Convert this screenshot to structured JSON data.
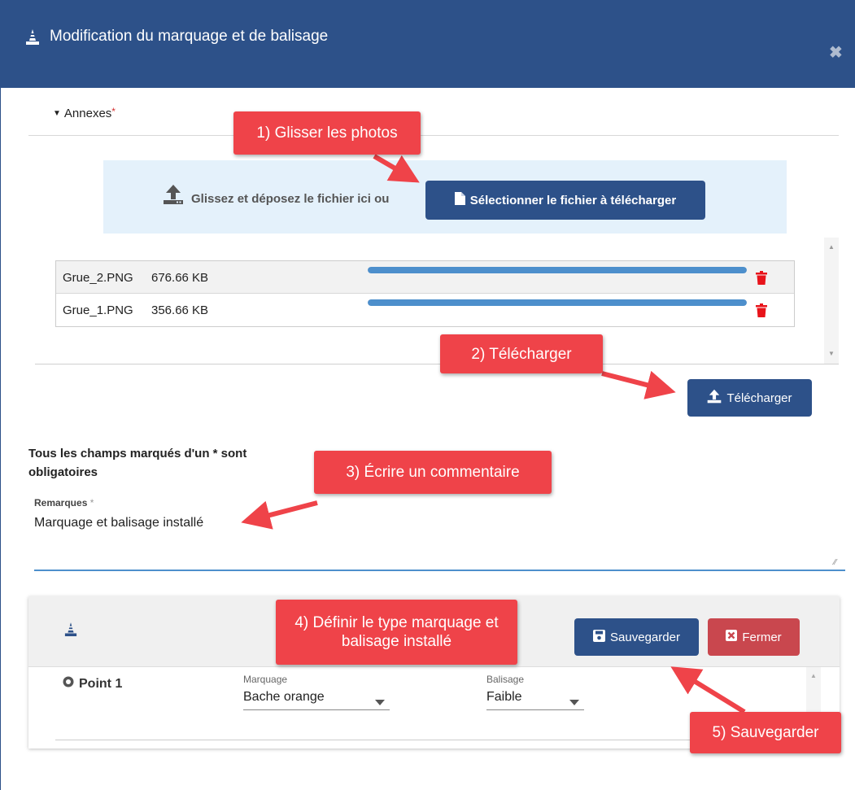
{
  "dialog": {
    "title": "Modification du marquage et de balisage",
    "close_symbol": "✖"
  },
  "annexes": {
    "label": "Annexes",
    "required_mark": "*"
  },
  "dropzone": {
    "text": "Glissez et déposez le fichier ici ou",
    "select_button": "Sélectionner le fichier à télécharger"
  },
  "files": [
    {
      "name": "Grue_2.PNG",
      "size": "676.66 KB",
      "progress": 1.0
    },
    {
      "name": "Grue_1.PNG",
      "size": "356.66 KB",
      "progress": 1.0
    }
  ],
  "upload_button": "Télécharger",
  "form": {
    "required_note": "Tous les champs marqués d'un * sont obligatoires",
    "remarks_label": "Remarques",
    "remarks_required": "*",
    "remarks_value": "Marquage et balisage installé"
  },
  "card": {
    "save_button": "Sauvegarder",
    "close_button": "Fermer",
    "point_label": "Point 1",
    "marquage_label": "Marquage",
    "marquage_value": "Bache orange",
    "balisage_label": "Balisage",
    "balisage_value": "Faible"
  },
  "callouts": {
    "step1": "1) Glisser les photos",
    "step2": "2) Télécharger",
    "step3": "3) Écrire un commentaire",
    "step4": "4) Définir le type marquage et balisage installé",
    "step5": "5) Sauvegarder"
  },
  "colors": {
    "header": "#2d5189",
    "primary_button": "#2d5189",
    "danger_button": "#c9474e",
    "callout": "#ef4349",
    "progress": "#4d8fcc",
    "trash": "#e8141b",
    "dropzone": "#e4f1fb"
  },
  "icons": [
    "traffic-cone-icon",
    "close-icon",
    "upload-icon",
    "file-icon",
    "trash-icon",
    "save-icon",
    "close-box-icon",
    "radio-icon",
    "chevron-down-icon"
  ]
}
